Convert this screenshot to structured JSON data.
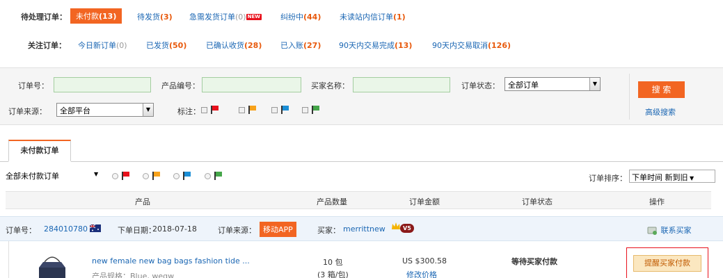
{
  "pending": {
    "title": "待处理订单：",
    "items": [
      {
        "label": "未付款",
        "count": "(13)"
      },
      {
        "label": "待发货",
        "count": "(3)"
      },
      {
        "label": "急需发货订单",
        "count": "(0)"
      },
      {
        "label": "纠纷中",
        "count": "(44)"
      },
      {
        "label": "未读站内信订单",
        "count": "(1)"
      }
    ],
    "new_badge": "NEW"
  },
  "watch": {
    "title": "关注订单：",
    "items": [
      {
        "label": "今日新订单",
        "count": "(0)"
      },
      {
        "label": "已发货",
        "count": "(50)"
      },
      {
        "label": "已确认收货",
        "count": "(28)"
      },
      {
        "label": "已入账",
        "count": "(27)"
      },
      {
        "label": "90天内交易完成",
        "count": "(13)"
      },
      {
        "label": "90天内交易取消",
        "count": "(126)"
      }
    ]
  },
  "search": {
    "order_no_label": "订单号：",
    "product_no_label": "产品编号：",
    "buyer_label": "买家名称：",
    "status_label": "订单状态：",
    "status_value": "全部订单",
    "source_label": "订单来源：",
    "source_value": "全部平台",
    "mark_label": "标注：",
    "search_button": "搜 索",
    "advanced_link": "高级搜索"
  },
  "tab": {
    "label": "未付款订单"
  },
  "filter": {
    "select_value": "全部未付款订单",
    "sort_label": "订单排序：",
    "sort_value": "下单时间 新到旧"
  },
  "columns": [
    "产品",
    "产品数量",
    "订单金额",
    "订单状态",
    "操作"
  ],
  "order": {
    "no_label": "订单号：",
    "no_value": "284010780",
    "date_label": "下单日期：",
    "date_value": "2018-07-18",
    "source_label": "订单来源：",
    "source_value": "移动APP",
    "buyer_label": "买家：",
    "buyer_value": "merrittnew",
    "buyer_level": "V5",
    "contact": "联系买家",
    "product_title": "new female new bag bags fashion tide ...",
    "product_spec": "产品规格：Blue, wegw",
    "qty": "10 包",
    "qty_sub": "(3 箱/包)",
    "amount": "US $300.58",
    "modify_price": "修改价格",
    "status": "等待买家付款",
    "remind": "提醒买家付款"
  },
  "colors": {
    "accent": "#f26522",
    "link": "#1a66b3",
    "count": "#e8590c",
    "flag_red": "#e8111c",
    "flag_orange": "#f7a21b",
    "flag_blue": "#1c8fd6",
    "flag_green": "#45a64a"
  }
}
